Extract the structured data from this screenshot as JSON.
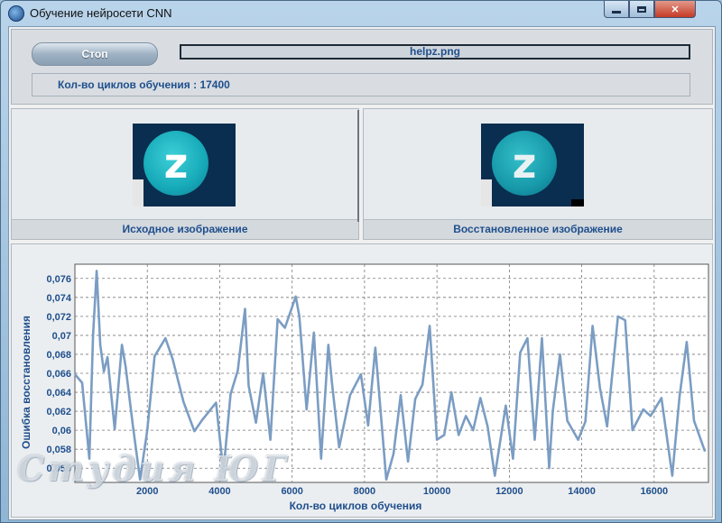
{
  "window": {
    "title": "Обучение нейросети CNN",
    "icon": "app-icon",
    "controls": [
      "minimize-icon",
      "maximize-icon",
      "close-icon"
    ],
    "close_glyph": "✕"
  },
  "top": {
    "stop_label": "Стоп",
    "file_name": "helpz.png",
    "cycles_text": "Кол-во циклов обучения : 17400"
  },
  "images": {
    "source_caption": "Исходное изображение",
    "restored_caption": "Восстановленное изображение",
    "letter": "z"
  },
  "watermark": "Студия ЮГ",
  "chart_data": {
    "type": "line",
    "title": "",
    "xlabel": "Кол-во циклов обучения",
    "ylabel": "Ошибка восстановления",
    "xlim": [
      0,
      17500
    ],
    "ylim": [
      0.0545,
      0.0775
    ],
    "xticks": [
      2000,
      4000,
      6000,
      8000,
      10000,
      12000,
      14000,
      16000
    ],
    "yticks": [
      0.056,
      0.058,
      0.06,
      0.062,
      0.064,
      0.066,
      0.068,
      0.07,
      0.072,
      0.074,
      0.076
    ],
    "ytick_labels": [
      "0,056",
      "0,058",
      "0,06",
      "0,062",
      "0,064",
      "0,066",
      "0,068",
      "0,07",
      "0,072",
      "0,074",
      "0,076"
    ],
    "grid": true,
    "series_color": "#7b9dc3",
    "x": [
      0,
      200,
      400,
      500,
      600,
      700,
      800,
      900,
      1100,
      1300,
      1400,
      1600,
      1800,
      2000,
      2200,
      2500,
      2700,
      3000,
      3300,
      3500,
      3900,
      4100,
      4300,
      4500,
      4700,
      4800,
      5000,
      5200,
      5400,
      5600,
      5800,
      6100,
      6200,
      6400,
      6600,
      6800,
      7000,
      7100,
      7300,
      7600,
      7900,
      8100,
      8300,
      8600,
      8800,
      9000,
      9200,
      9400,
      9600,
      9800,
      10000,
      10200,
      10400,
      10600,
      10800,
      11000,
      11200,
      11400,
      11600,
      11900,
      12100,
      12300,
      12500,
      12700,
      12900,
      13100,
      13200,
      13400,
      13600,
      13900,
      14100,
      14300,
      14500,
      14700,
      15000,
      15200,
      15400,
      15700,
      15900,
      16200,
      16500,
      16700,
      16900,
      17100,
      17400
    ],
    "values": [
      0.0659,
      0.065,
      0.057,
      0.07,
      0.0768,
      0.069,
      0.0662,
      0.0677,
      0.0601,
      0.069,
      0.0667,
      0.0605,
      0.0548,
      0.06,
      0.0678,
      0.0697,
      0.0675,
      0.063,
      0.0599,
      0.061,
      0.0629,
      0.0556,
      0.0638,
      0.0663,
      0.0728,
      0.0647,
      0.0608,
      0.066,
      0.059,
      0.0717,
      0.0708,
      0.0741,
      0.072,
      0.0622,
      0.0703,
      0.057,
      0.069,
      0.065,
      0.0582,
      0.0637,
      0.0659,
      0.0605,
      0.0687,
      0.0548,
      0.0575,
      0.0637,
      0.0567,
      0.0633,
      0.0648,
      0.071,
      0.059,
      0.0595,
      0.064,
      0.0595,
      0.0615,
      0.06,
      0.0634,
      0.0604,
      0.0552,
      0.0626,
      0.057,
      0.0682,
      0.0697,
      0.059,
      0.0697,
      0.056,
      0.062,
      0.068,
      0.061,
      0.059,
      0.0609,
      0.071,
      0.0645,
      0.0604,
      0.072,
      0.0716,
      0.06,
      0.0622,
      0.0615,
      0.0634,
      0.0552,
      0.0635,
      0.0693,
      0.061,
      0.0578
    ]
  }
}
